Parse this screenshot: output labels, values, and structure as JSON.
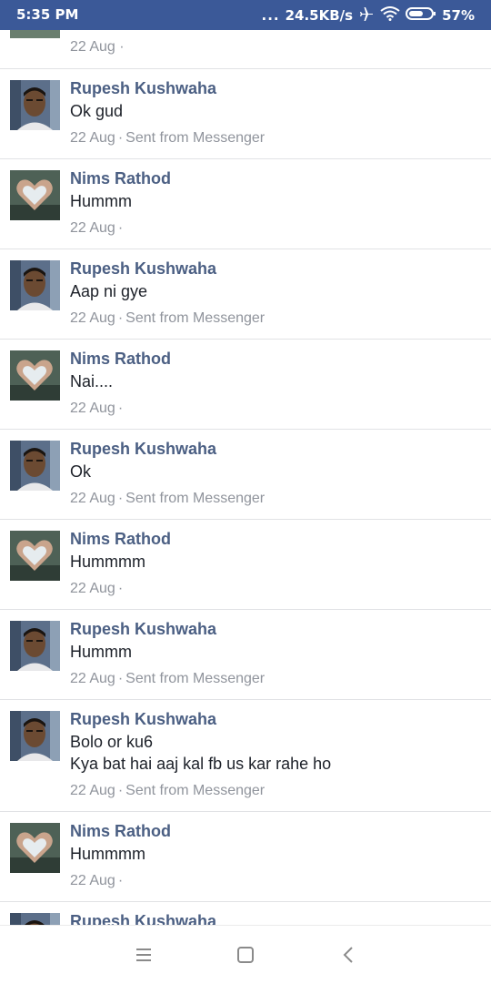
{
  "status_bar": {
    "time": "5:35 PM",
    "signal_dots": "...",
    "network_speed": "24.5KB/s",
    "battery": "57%",
    "icons": [
      "airplane-icon",
      "wifi-icon",
      "battery-icon"
    ]
  },
  "thread": {
    "partial_top": {
      "date": "22 Aug",
      "suffix": "·"
    },
    "messages": [
      {
        "sender": "Rupesh Kushwaha",
        "avatar": "rupesh",
        "lines": [
          "Ok gud"
        ],
        "date": "22 Aug",
        "source": "Sent from Messenger"
      },
      {
        "sender": "Nims Rathod",
        "avatar": "nims",
        "lines": [
          "Hummm"
        ],
        "date": "22 Aug",
        "source": ""
      },
      {
        "sender": "Rupesh Kushwaha",
        "avatar": "rupesh",
        "lines": [
          "Aap ni gye"
        ],
        "date": "22 Aug",
        "source": "Sent from Messenger"
      },
      {
        "sender": "Nims Rathod",
        "avatar": "nims",
        "lines": [
          "Nai...."
        ],
        "date": "22 Aug",
        "source": ""
      },
      {
        "sender": "Rupesh Kushwaha",
        "avatar": "rupesh",
        "lines": [
          "Ok"
        ],
        "date": "22 Aug",
        "source": "Sent from Messenger"
      },
      {
        "sender": "Nims Rathod",
        "avatar": "nims",
        "lines": [
          "Hummmm"
        ],
        "date": "22 Aug",
        "source": ""
      },
      {
        "sender": "Rupesh Kushwaha",
        "avatar": "rupesh",
        "lines": [
          "Hummm"
        ],
        "date": "22 Aug",
        "source": "Sent from Messenger"
      },
      {
        "sender": "Rupesh Kushwaha",
        "avatar": "rupesh",
        "lines": [
          "Bolo or ku6",
          "Kya bat hai aaj kal fb us kar rahe ho"
        ],
        "date": "22 Aug",
        "source": "Sent from Messenger"
      },
      {
        "sender": "Nims Rathod",
        "avatar": "nims",
        "lines": [
          "Hummmm"
        ],
        "date": "22 Aug",
        "source": ""
      },
      {
        "sender": "Rupesh Kushwaha",
        "avatar": "rupesh",
        "lines": [],
        "date": "",
        "source": ""
      }
    ]
  },
  "nav_bar": {
    "buttons": [
      "menu-icon",
      "home-icon",
      "back-icon"
    ]
  },
  "colors": {
    "status_bar_bg": "#3b5998",
    "sender_name": "#4b5f83",
    "meta_text": "#90949c",
    "body_text": "#1d2129",
    "divider": "#e1e2e5"
  }
}
